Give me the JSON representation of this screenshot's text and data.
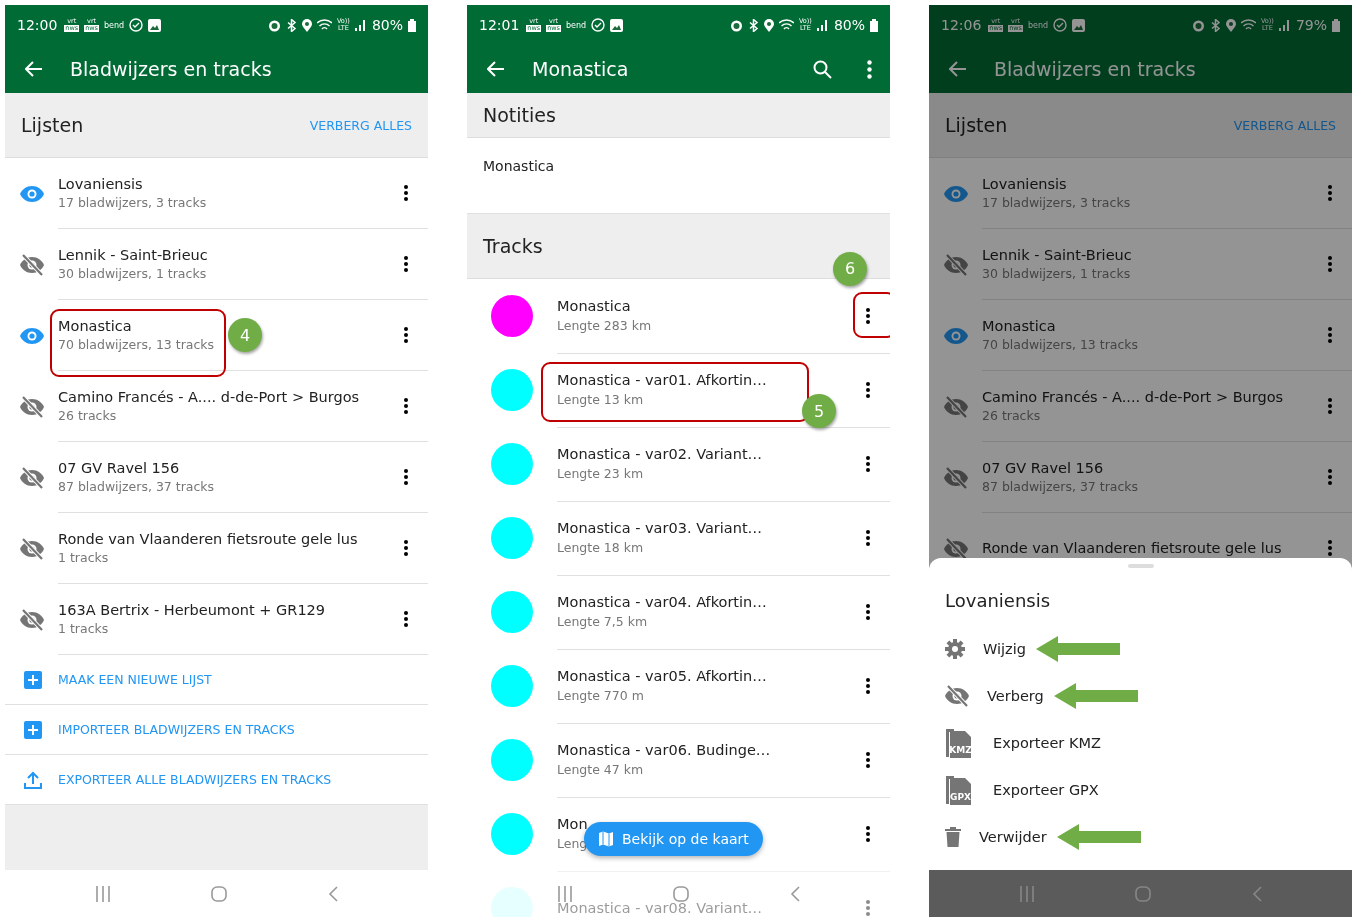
{
  "screens": [
    {
      "kind": "lists",
      "status_bar": {
        "time": "12:00",
        "battery": "80%",
        "notifications": [
          {
            "kind": "badge",
            "top": "vrt",
            "bottom": "nws"
          },
          {
            "kind": "badge",
            "top": "vrt",
            "bottom": "nws"
          },
          {
            "kind": "text",
            "text": "bend"
          }
        ],
        "volte": {
          "top": "Vo))",
          "bottom": "LTE"
        }
      },
      "app_bar": {
        "title": "Bladwijzers en tracks"
      },
      "header": {
        "title": "Lijsten",
        "action": "VERBERG ALLES"
      },
      "lists": [
        {
          "name": "Lovaniensis",
          "details": "17 bladwijzers, 3 tracks",
          "visible": true
        },
        {
          "name": "Lennik - Saint-Brieuc",
          "details": "30 bladwijzers, 1 tracks",
          "visible": false
        },
        {
          "name": "Monastica",
          "details": "70 bladwijzers, 13 tracks",
          "visible": true,
          "callout": {
            "label": "4",
            "kind": "text"
          }
        },
        {
          "name": "Camino Francés - A.... d-de-Port >  Burgos",
          "details": "26 tracks",
          "visible": false
        },
        {
          "name": "07 GV Ravel 156",
          "details": "87 bladwijzers, 37 tracks",
          "visible": false
        },
        {
          "name": "Ronde van Vlaanderen fietsroute gele lus",
          "details": "1 tracks",
          "visible": false
        },
        {
          "name": "163A Bertrix - Herbeumont + GR129",
          "details": "1 tracks",
          "visible": false
        }
      ],
      "actions": [
        {
          "kind": "plus",
          "label": "MAAK EEN NIEUWE LIJST"
        },
        {
          "kind": "plus",
          "label": "IMPORTEER BLADWIJZERS EN TRACKS"
        },
        {
          "kind": "upload",
          "label": "EXPORTEER ALLE BLADWIJZERS EN TRACKS"
        }
      ]
    },
    {
      "kind": "tracks",
      "status_bar": {
        "time": "12:01",
        "battery": "80%",
        "notifications": [
          {
            "kind": "badge",
            "top": "vrt",
            "bottom": "nws"
          },
          {
            "kind": "badge",
            "top": "vrt",
            "bottom": "nws"
          },
          {
            "kind": "text",
            "text": "bend"
          }
        ],
        "volte": {
          "top": "Vo))",
          "bottom": "LTE"
        }
      },
      "app_bar": {
        "title": "Monastica",
        "actions": [
          {
            "kind": "search"
          },
          {
            "kind": "more"
          }
        ]
      },
      "notes": {
        "title": "Notities",
        "text": "Monastica"
      },
      "tracks_title": "Tracks",
      "tracks": [
        {
          "name": "Monastica",
          "length": "Lengte 283 km",
          "color": "#ff00ff",
          "callout": {
            "label": "6",
            "kind": "menu"
          }
        },
        {
          "name": "Monastica - var01. Afkortin…",
          "length": "Lengte 13 km",
          "color": "#00ffff",
          "callout": {
            "label": "5",
            "kind": "text"
          }
        },
        {
          "name": "Monastica - var02. Variant…",
          "length": "Lengte 23 km",
          "color": "#00ffff"
        },
        {
          "name": "Monastica - var03. Variant…",
          "length": "Lengte 18 km",
          "color": "#00ffff"
        },
        {
          "name": "Monastica - var04. Afkortin…",
          "length": "Lengte 7,5 km",
          "color": "#00ffff"
        },
        {
          "name": "Monastica - var05. Afkortin…",
          "length": "Lengte 770 m",
          "color": "#00ffff"
        },
        {
          "name": "Monastica - var06. Budinge…",
          "length": "Lengte 47 km",
          "color": "#00ffff"
        },
        {
          "name": "Mon",
          "length": "Leng",
          "color": "#00ffff"
        },
        {
          "name": "Monastica - var08. Variant…"
        }
      ],
      "fab": {
        "label": "Bekijk op de kaart"
      }
    },
    {
      "kind": "sheet",
      "dimmed": true,
      "status_bar": {
        "time": "12:06",
        "battery": "79%",
        "notifications": [
          {
            "kind": "badge",
            "top": "vrt",
            "bottom": "nws"
          },
          {
            "kind": "badge",
            "top": "vrt",
            "bottom": "nws"
          },
          {
            "kind": "text",
            "text": "bend"
          }
        ],
        "volte": {
          "top": "Vo))",
          "bottom": "LTE"
        }
      },
      "app_bar": {
        "title": "Bladwijzers en tracks"
      },
      "header": {
        "title": "Lijsten",
        "action": "VERBERG ALLES"
      },
      "lists": [
        {
          "name": "Lovaniensis",
          "details": "17 bladwijzers, 3 tracks",
          "visible": true
        },
        {
          "name": "Lennik - Saint-Brieuc",
          "details": "30 bladwijzers, 1 tracks",
          "visible": false
        },
        {
          "name": "Monastica",
          "details": "70 bladwijzers, 13 tracks",
          "visible": true
        },
        {
          "name": "Camino Francés - A.... d-de-Port >  Burgos",
          "details": "26 tracks",
          "visible": false
        },
        {
          "name": "07 GV Ravel 156",
          "details": "87 bladwijzers, 37 tracks",
          "visible": false
        },
        {
          "name": "Ronde van Vlaanderen fietsroute gele lus",
          "visible": false
        }
      ],
      "sheet": {
        "title": "Lovaniensis",
        "options": [
          {
            "kind": "gear",
            "label": "Wijzig",
            "arrow": true
          },
          {
            "kind": "hide",
            "label": "Verberg",
            "arrow": true
          },
          {
            "kind": "file",
            "icon_label": "KMZ",
            "label": "Exporteer KMZ",
            "arrow": false
          },
          {
            "kind": "file",
            "icon_label": "GPX",
            "label": "Exporteer GPX",
            "arrow": false
          },
          {
            "kind": "trash",
            "label": "Verwijder",
            "arrow": true
          }
        ]
      }
    }
  ]
}
